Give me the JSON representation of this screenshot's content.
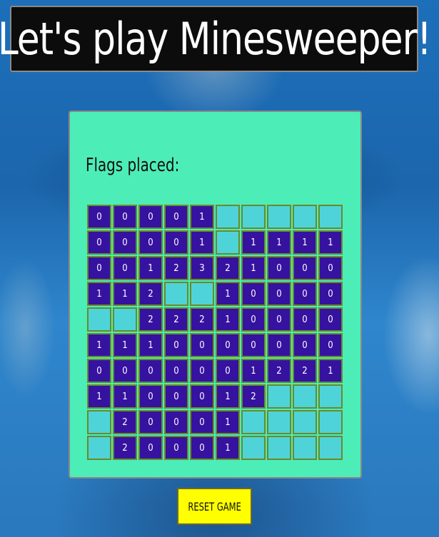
{
  "title": "Let's play Minesweeper!",
  "flags": {
    "label": "Flags placed:",
    "count": ""
  },
  "board": {
    "rows": [
      [
        "0",
        "0",
        "0",
        "0",
        "1",
        "",
        "",
        "",
        "",
        ""
      ],
      [
        "0",
        "0",
        "0",
        "0",
        "1",
        "",
        "1",
        "1",
        "1",
        "1"
      ],
      [
        "0",
        "0",
        "1",
        "2",
        "3",
        "2",
        "1",
        "0",
        "0",
        "0"
      ],
      [
        "1",
        "1",
        "2",
        "",
        "",
        "1",
        "0",
        "0",
        "0",
        "0"
      ],
      [
        "",
        "",
        "2",
        "2",
        "2",
        "1",
        "0",
        "0",
        "0",
        "0"
      ],
      [
        "1",
        "1",
        "1",
        "0",
        "0",
        "0",
        "0",
        "0",
        "0",
        "0"
      ],
      [
        "0",
        "0",
        "0",
        "0",
        "0",
        "0",
        "1",
        "2",
        "2",
        "1"
      ],
      [
        "1",
        "1",
        "0",
        "0",
        "0",
        "1",
        "2",
        "",
        "",
        ""
      ],
      [
        "",
        "2",
        "0",
        "0",
        "0",
        "1",
        "",
        "",
        "",
        ""
      ],
      [
        "",
        "2",
        "0",
        "0",
        "0",
        "1",
        "",
        "",
        "",
        ""
      ]
    ]
  },
  "reset_button": {
    "label": "RESET GAME"
  },
  "colors": {
    "panel": "#4dedb8",
    "revealed_cell": "#3612a0",
    "hidden_cell": "#4ed4d8",
    "reset_button": "#ffff00",
    "title_bg": "#0c0c0c"
  }
}
